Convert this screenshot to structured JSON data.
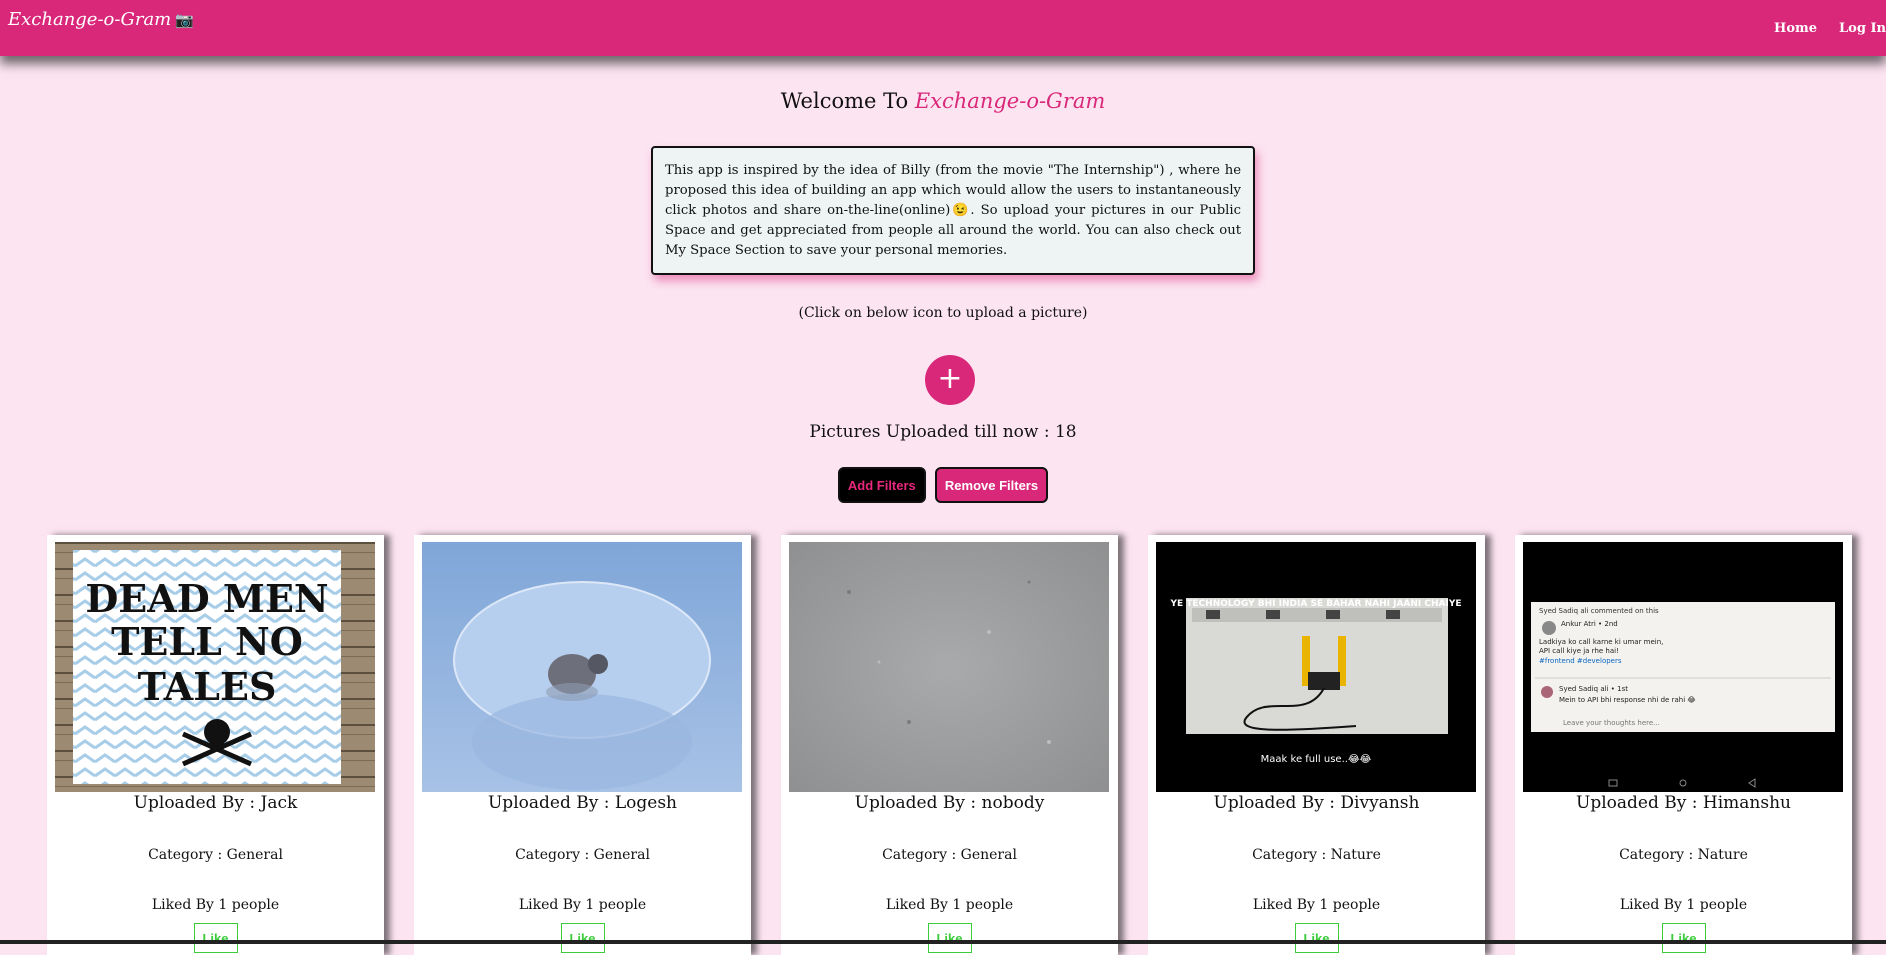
{
  "navbar": {
    "brand": "Exchange-o-Gram",
    "brand_icon": "📷",
    "links": [
      "Home",
      "Log In"
    ]
  },
  "welcome": {
    "prefix": "Welcome To",
    "app_name": "Exchange-o-Gram"
  },
  "intro": {
    "text": "This app is inspired by the idea of Billy (from the movie \"The Internship\") , where he proposed this idea of building an app which would allow the users to instantaneously click photos and share on-the-line(online)😉. So upload your pictures in our Public Space and get appreciated from people all around the world. You can also check out My Space Section to save your personal memories."
  },
  "upload": {
    "hint": "(Click on below icon to upload a picture)",
    "icon": "+"
  },
  "count_text": "Pictures Uploaded till now : 18",
  "filters": {
    "add_label": "Add Filters",
    "remove_label": "Remove Filters"
  },
  "poster": {
    "line1": "DEAD MEN",
    "line2": "TELL NO",
    "line3": "TALES"
  },
  "meme": {
    "caption_top": "YE TECHNOLOGY BHI INDIA SE BAHAR NAHI JAANI CHAIYE",
    "caption_bottom": "Maak ke full use..😂😂"
  },
  "screenshot": {
    "header": "Syed Sadiq ali commented on this",
    "author": "Ankur Atri • 2nd",
    "line1": "Ladkiya ko call karne ki umar mein,",
    "line2": "API call kiye ja rhe hai!",
    "tags": "#frontend #developers",
    "reply_author": "Syed Sadiq ali • 1st",
    "reply": "Mein to API bhi response nhi de rahi 😂",
    "input": "Leave your thoughts here..."
  },
  "cards": [
    {
      "uploader": "Uploaded By : Jack",
      "category": "Category : General",
      "likes": "Liked By 1 people",
      "like": "Like",
      "image": "pirate-poster"
    },
    {
      "uploader": "Uploaded By : Logesh",
      "category": "Category : General",
      "likes": "Liked By 1 people",
      "like": "Like",
      "image": "bird-bubble"
    },
    {
      "uploader": "Uploaded By : nobody",
      "category": "Category : General",
      "likes": "Liked By 1 people",
      "like": "Like",
      "image": "grey-texture"
    },
    {
      "uploader": "Uploaded By : Divyansh",
      "category": "Category : Nature",
      "likes": "Liked By 1 people",
      "like": "Like",
      "image": "charger-meme"
    },
    {
      "uploader": "Uploaded By : Himanshu",
      "category": "Category : Nature",
      "likes": "Liked By 1 people",
      "like": "Like",
      "image": "social-screenshot"
    }
  ],
  "colors": {
    "accent": "#d9287a",
    "background": "#fce4f1",
    "like_green": "#3ccc3c"
  }
}
